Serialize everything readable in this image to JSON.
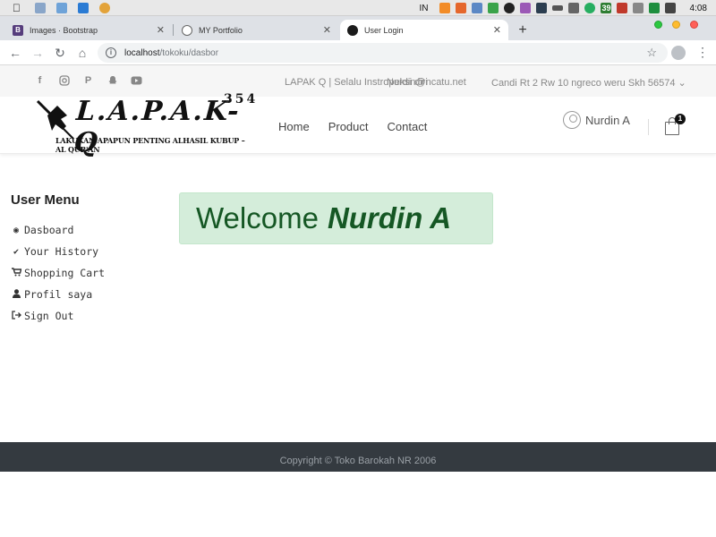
{
  "os": {
    "input_language": "IN",
    "clock": "4:08",
    "tray_badge": "39"
  },
  "browser": {
    "tabs": [
      {
        "label": "Images · Bootstrap",
        "favicon": "bootstrap-icon"
      },
      {
        "label": "MY Portfolio",
        "favicon": "globe-icon"
      },
      {
        "label": "User Login",
        "favicon": "site-icon",
        "active": true
      }
    ],
    "url": {
      "host": "localhost",
      "path": "/tokoku/dasbor"
    }
  },
  "site": {
    "topbar": {
      "tagline": "LAPAK Q | Selalu Instropeksi diri",
      "email": "Nurdin@ncatu.net",
      "address": "Candi Rt 2 Rw 10 ngreco weru Skh 56574"
    },
    "logo": {
      "brand": "L.A.P.A.K-Q",
      "tagline": "LAKUKAN APAPUN PENTING ALHASIL KUBUP – AL QUR'AN",
      "number": "354"
    },
    "nav": [
      "Home",
      "Product",
      "Contact"
    ],
    "user": "Nurdin A",
    "cart_count": "1"
  },
  "sidebar": {
    "title": "User Menu",
    "items": [
      {
        "label": "Dasboard",
        "icon": "dashboard-icon"
      },
      {
        "label": "Your History",
        "icon": "check-icon"
      },
      {
        "label": "Shopping Cart",
        "icon": "cart-icon"
      },
      {
        "label": "Profil saya",
        "icon": "user-icon"
      },
      {
        "label": "Sign Out",
        "icon": "sign-out-icon"
      }
    ]
  },
  "main": {
    "welcome_prefix": "Welcome",
    "welcome_name": "Nurdin A"
  },
  "footer": {
    "copyright": "Copyright © Toko Barokah NR 2006"
  },
  "colors": {
    "welcome_bg": "#d4edda",
    "welcome_text": "#155724",
    "footer_bg": "#343a40"
  }
}
